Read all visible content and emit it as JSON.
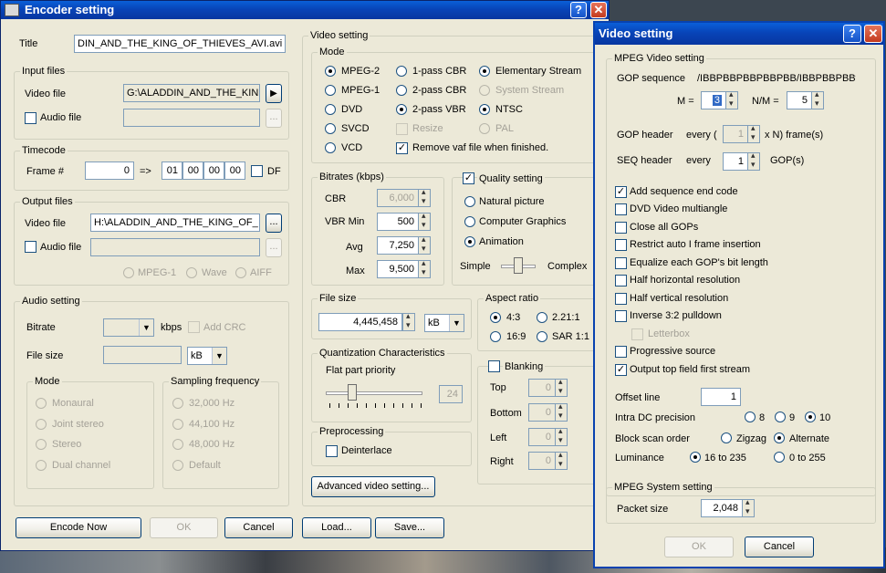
{
  "encoder": {
    "title": "Encoder setting",
    "title_label": "Title",
    "title_value": "DIN_AND_THE_KING_OF_THIEVES_AVI.avi",
    "input_files": {
      "legend": "Input files",
      "video_label": "Video file",
      "video_value": "G:\\ALADDIN_AND_THE_KIN",
      "audio_label": "Audio file",
      "browse": "..."
    },
    "timecode": {
      "legend": "Timecode",
      "frame_label": "Frame #",
      "frame_value": "0",
      "arrow": "=>",
      "tc": [
        "01",
        "00",
        "00",
        "00"
      ],
      "df_label": "DF"
    },
    "output_files": {
      "legend": "Output files",
      "video_label": "Video file",
      "video_value": "H:\\ALADDIN_AND_THE_KING_OF_",
      "audio_label": "Audio file",
      "browse": "...",
      "formats": [
        "MPEG-1",
        "Wave",
        "AIFF"
      ]
    },
    "audio_setting": {
      "legend": "Audio setting",
      "bitrate_label": "Bitrate",
      "kbps": "kbps",
      "add_crc": "Add CRC",
      "file_size_label": "File size",
      "unit": "kB",
      "mode_legend": "Mode",
      "modes": [
        "Monaural",
        "Joint stereo",
        "Stereo",
        "Dual channel"
      ],
      "sampling_legend": "Sampling frequency",
      "freqs": [
        "32,000 Hz",
        "44,100 Hz",
        "48,000 Hz",
        "Default"
      ]
    },
    "video_setting": {
      "legend": "Video setting",
      "mode_legend": "Mode",
      "modes_col1": [
        "MPEG-2",
        "MPEG-1",
        "DVD",
        "SVCD",
        "VCD"
      ],
      "modes_col2": [
        "1-pass CBR",
        "2-pass CBR",
        "2-pass VBR",
        "Resize"
      ],
      "modes_col3": [
        "Elementary Stream",
        "System Stream",
        "NTSC",
        "PAL"
      ],
      "remove_vaf": "Remove vaf file when finished.",
      "bitrates_legend": "Bitrates (kbps)",
      "cbr_label": "CBR",
      "cbr_value": "6,000",
      "vbr_min_label": "VBR Min",
      "vbr_min_value": "500",
      "avg_label": "Avg",
      "avg_value": "7,250",
      "max_label": "Max",
      "max_value": "9,500",
      "quality_label": "Quality setting",
      "quality_opts": [
        "Natural picture",
        "Computer Graphics",
        "Animation"
      ],
      "simple": "Simple",
      "complex": "Complex",
      "file_size_legend": "File size",
      "file_size_value": "4,445,458",
      "file_size_unit": "kB",
      "aspect_legend": "Aspect ratio",
      "aspects": [
        "4:3",
        "2.21:1",
        "16:9",
        "SAR 1:1"
      ],
      "quant_legend": "Quantization Characteristics",
      "flat_label": "Flat part priority",
      "flat_value": "24",
      "blanking_label": "Blanking",
      "blank_rows": [
        "Top",
        "Bottom",
        "Left",
        "Right"
      ],
      "blank_val": "0",
      "preproc_legend": "Preprocessing",
      "deinterlace": "Deinterlace",
      "advanced": "Advanced video setting..."
    },
    "buttons": {
      "encode": "Encode Now",
      "ok": "OK",
      "cancel": "Cancel",
      "load": "Load...",
      "save": "Save..."
    }
  },
  "video_dialog": {
    "title": "Video setting",
    "mpeg_video_legend": "MPEG Video setting",
    "gop_seq_label": "GOP sequence",
    "gop_seq_value": "/IBBPBBPBBPBBPBB/IBBPBBPBBf",
    "m_label": "M =",
    "m_value": "3",
    "nm_label": "N/M =",
    "nm_value": "5",
    "gop_header_label": "GOP header",
    "every1": "every (",
    "gop_every_value": "1",
    "xn": "x N) frame(s)",
    "seq_header_label": "SEQ header",
    "every2": "every",
    "seq_every_value": "1",
    "gops": "GOP(s)",
    "options": [
      {
        "label": "Add sequence end code",
        "checked": true
      },
      {
        "label": "DVD Video multiangle",
        "checked": false
      },
      {
        "label": "Close all GOPs",
        "checked": false
      },
      {
        "label": "Restrict auto I frame insertion",
        "checked": false
      },
      {
        "label": "Equalize each GOP's bit length",
        "checked": false
      },
      {
        "label": "Half horizontal resolution",
        "checked": false
      },
      {
        "label": "Half vertical resolution",
        "checked": false
      },
      {
        "label": "Inverse 3:2 pulldown",
        "checked": false
      },
      {
        "label": "Letterbox",
        "checked": false
      },
      {
        "label": "Progressive source",
        "checked": false
      },
      {
        "label": "Output top field first stream",
        "checked": true
      }
    ],
    "offset_label": "Offset line",
    "offset_value": "1",
    "intra_label": "Intra DC precision",
    "intra_opts": [
      "8",
      "9",
      "10"
    ],
    "scan_label": "Block scan order",
    "scan_opts": [
      "Zigzag",
      "Alternate"
    ],
    "lum_label": "Luminance",
    "lum_opts": [
      "16 to 235",
      "0 to 255"
    ],
    "mpeg_system_legend": "MPEG System setting",
    "packet_label": "Packet size",
    "packet_value": "2,048",
    "ok": "OK",
    "cancel": "Cancel"
  }
}
